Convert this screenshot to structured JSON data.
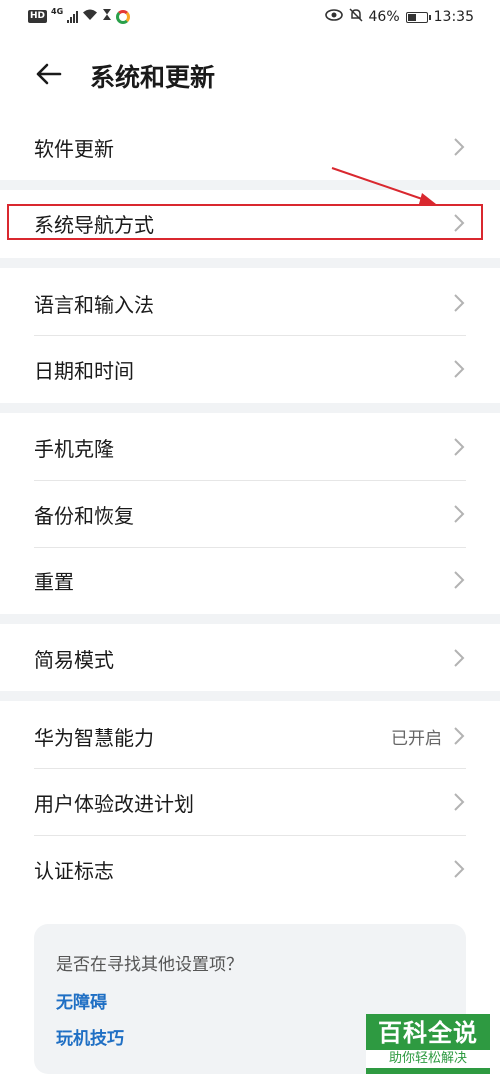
{
  "status_bar": {
    "hd": "HD",
    "network": "4G",
    "battery_percent_text": "46%",
    "battery_level": 0.46,
    "time": "13:35"
  },
  "header": {
    "title": "系统和更新"
  },
  "groups": [
    {
      "items": [
        {
          "label": "软件更新",
          "value": ""
        }
      ]
    },
    {
      "items": [
        {
          "label": "系统导航方式",
          "value": ""
        }
      ]
    },
    {
      "items": [
        {
          "label": "语言和输入法",
          "value": ""
        },
        {
          "label": "日期和时间",
          "value": ""
        }
      ]
    },
    {
      "items": [
        {
          "label": "手机克隆",
          "value": ""
        },
        {
          "label": "备份和恢复",
          "value": ""
        },
        {
          "label": "重置",
          "value": ""
        }
      ]
    },
    {
      "items": [
        {
          "label": "简易模式",
          "value": ""
        }
      ]
    },
    {
      "items": [
        {
          "label": "华为智慧能力",
          "value": "已开启"
        },
        {
          "label": "用户体验改进计划",
          "value": ""
        },
        {
          "label": "认证标志",
          "value": ""
        }
      ]
    }
  ],
  "suggestions": {
    "title": "是否在寻找其他设置项？",
    "links": [
      "无障碍",
      "玩机技巧"
    ]
  },
  "watermark": {
    "brand": "百科全说",
    "slogan": "助你轻松解决"
  },
  "colors": {
    "accent_link": "#1f6fc4",
    "annotation_red": "#d9282f",
    "watermark_green": "#2e9a41",
    "gap_gray": "#f1f3f5"
  }
}
